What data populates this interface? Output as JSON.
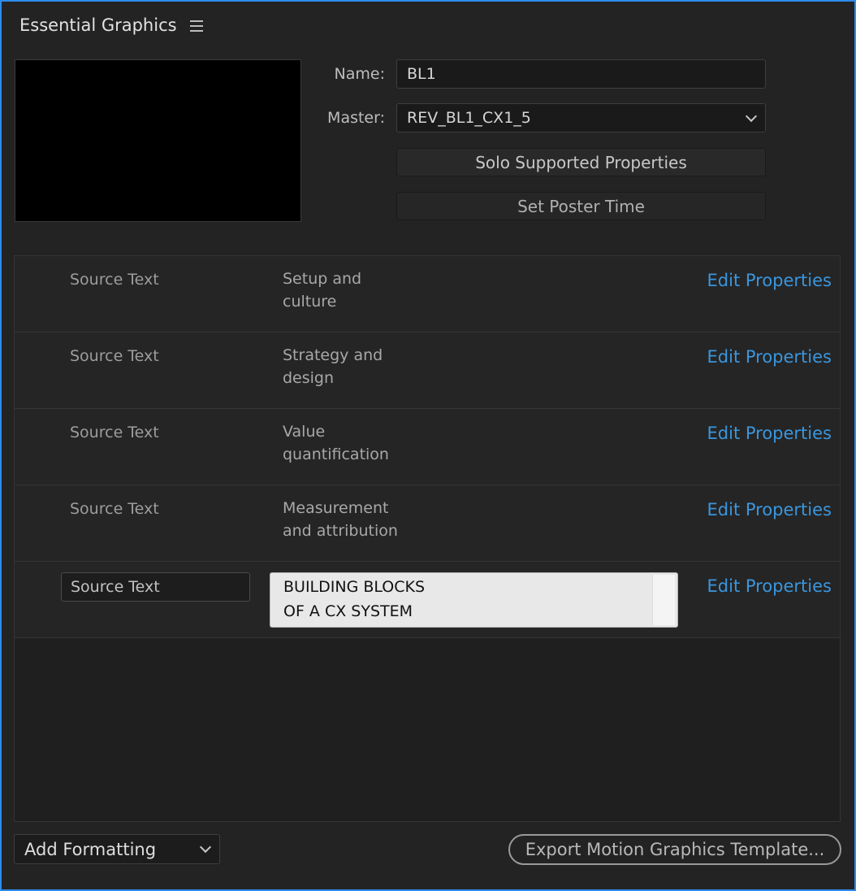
{
  "panel": {
    "title": "Essential Graphics",
    "menu_icon": "hamburger-menu-icon"
  },
  "properties": {
    "name_label": "Name:",
    "name_value": "BL1",
    "master_label": "Master:",
    "master_value": "REV_BL1_CX1_5",
    "solo_button": "Solo Supported Properties",
    "poster_button": "Set Poster Time"
  },
  "rows": [
    {
      "type": "Source Text",
      "line1": "Setup and",
      "line2": "culture",
      "action": "Edit Properties"
    },
    {
      "type": "Source Text",
      "line1": "Strategy and",
      "line2": "design",
      "action": "Edit Properties"
    },
    {
      "type": "Source Text",
      "line1": "Value",
      "line2": "quantification",
      "action": "Edit Properties"
    },
    {
      "type": "Source Text",
      "line1": "Measurement",
      "line2": "and attribution",
      "action": "Edit Properties"
    },
    {
      "type": "Source Text",
      "line1": "BUILDING BLOCKS",
      "line2": "OF A CX SYSTEM",
      "action": "Edit Properties"
    }
  ],
  "footer": {
    "add_formatting": "Add Formatting",
    "export_button": "Export Motion Graphics Template..."
  },
  "colors": {
    "accent_border": "#2d8ceb",
    "link": "#3a96de"
  }
}
